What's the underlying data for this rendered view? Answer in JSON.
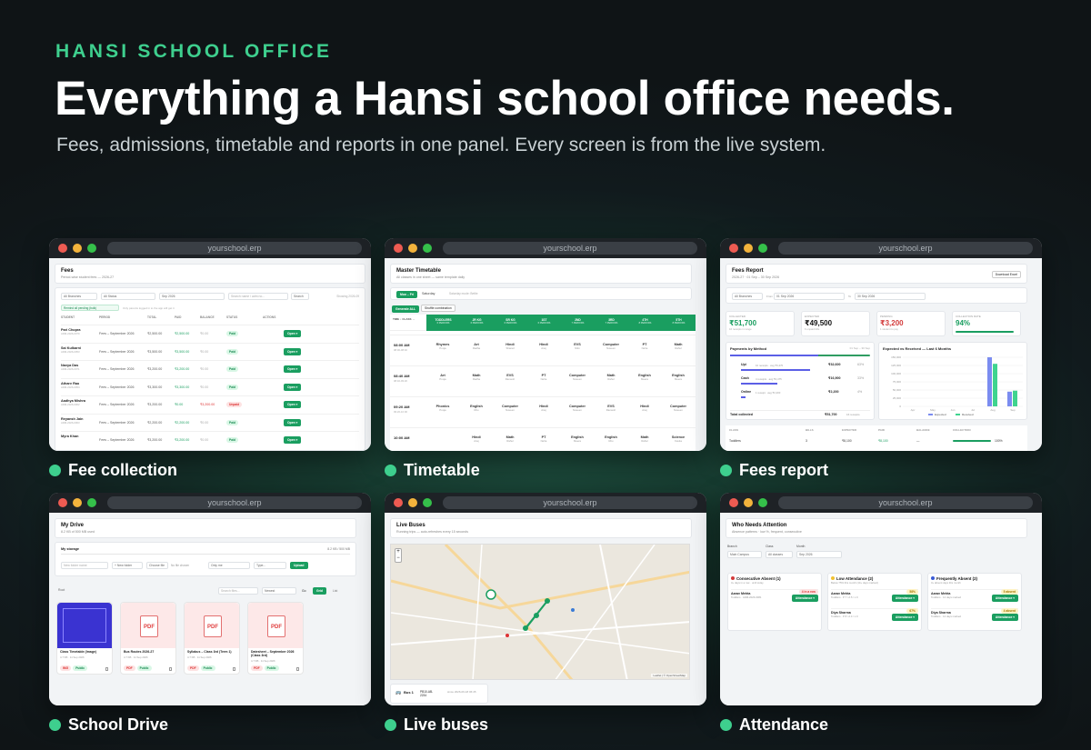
{
  "hero": {
    "eyebrow": "HANSI SCHOOL OFFICE",
    "headline": "Everything a Hansi school office needs.",
    "subheadline": "Fees, admissions, timetable and reports in one panel. Every screen is from the live system."
  },
  "browser_url": "yourschool.erp",
  "captions": {
    "fees": "Fee collection",
    "timetable": "Timetable",
    "report": "Fees report",
    "drive": "School Drive",
    "buses": "Live buses",
    "attendance": "Attendance"
  },
  "fees": {
    "title": "Fees",
    "subtitle": "Period-wise student fees — 2026-27",
    "filter_branch": "All Branches",
    "filter_status": "All Status",
    "filter_month": "Sep 2026",
    "search_placeholder": "Search name / adm no...",
    "search_button": "Search",
    "showing": "Showing 2026-09",
    "remind_button": "Remind all pending (bulk)",
    "remind_note": "Only parents logged in to the app will get it",
    "headers": [
      "STUDENT",
      "PERIOD",
      "TOTAL",
      "PAID",
      "BALANCE",
      "STATUS",
      "ACTIONS"
    ],
    "open_label": "Open ▾",
    "rows": [
      {
        "name": "Pari Chopra",
        "adm": "ADM-2026-0079",
        "period": "Fees – September 2026",
        "total": "₹2,500.00",
        "paid": "₹2,500.00",
        "balance": "₹0.00",
        "status": "Paid"
      },
      {
        "name": "Sai Kulkarni",
        "adm": "ADM-2026-0053",
        "period": "Fees – September 2026",
        "total": "₹3,500.00",
        "paid": "₹3,500.00",
        "balance": "₹0.00",
        "status": "Paid"
      },
      {
        "name": "Navya Das",
        "adm": "ADM-2026-0071",
        "period": "Fees – September 2026",
        "total": "₹3,200.00",
        "paid": "₹3,200.00",
        "balance": "₹0.00",
        "status": "Paid"
      },
      {
        "name": "Atharv Rao",
        "adm": "ADM-2026-0054",
        "period": "Fees – September 2026",
        "total": "₹3,300.00",
        "paid": "₹3,300.00",
        "balance": "₹0.00",
        "status": "Paid"
      },
      {
        "name": "Aadhya Mishra",
        "adm": "ADM-2026-0062",
        "period": "Fees – September 2026",
        "total": "₹3,200.00",
        "paid": "₹0.00",
        "balance": "₹3,200.00",
        "status": "Unpaid"
      },
      {
        "name": "Reyansh Jain",
        "adm": "ADM-2026-0063",
        "period": "Fees – September 2026",
        "total": "₹2,200.00",
        "paid": "₹2,200.00",
        "balance": "₹0.00",
        "status": "Paid"
      },
      {
        "name": "Myra Khan",
        "adm": "",
        "period": "Fees – September 2026",
        "total": "₹3,200.00",
        "paid": "₹3,200.00",
        "balance": "₹0.00",
        "status": "Paid"
      }
    ]
  },
  "timetable": {
    "title": "Master Timetable",
    "subtitle": "All classes in one sheet — same template daily",
    "tab_active": "Mon – Fri",
    "tab_other": "Saturday",
    "tab_note": "Saturday mode: Bettie",
    "generate": "Generate ALL",
    "shuffle": "Shuffle combination",
    "corner": "TIME ↓ CLASS →",
    "classes": [
      {
        "name": "TODDLERS",
        "sub": "6 PERIODS"
      },
      {
        "name": "JR KG",
        "sub": "6 PERIODS"
      },
      {
        "name": "SR KG",
        "sub": "6 PERIODS"
      },
      {
        "name": "1ST",
        "sub": "6 PERIODS"
      },
      {
        "name": "2ND",
        "sub": "7 PERIODS"
      },
      {
        "name": "3RD",
        "sub": "7 PERIODS"
      },
      {
        "name": "4TH",
        "sub": "8 PERIODS"
      },
      {
        "name": "5TH",
        "sub": "8 PERIODS"
      }
    ],
    "rows": [
      {
        "time": "08:00 AM",
        "range": "08:00-08:40",
        "cells": [
          [
            "Rhymes",
            "Pooja"
          ],
          [
            "Art",
            "Radha"
          ],
          [
            "Hindi",
            "Sharad"
          ],
          [
            "Hindi",
            "Anuj"
          ],
          [
            "EVS",
            "Nitin"
          ],
          [
            "Computer",
            "Naveen"
          ],
          [
            "PT",
            "Neha"
          ],
          [
            "Math",
            "Rahul"
          ]
        ]
      },
      {
        "time": "08:40 AM",
        "range": "08:40-09:20",
        "cells": [
          [
            "Art",
            "Pooja"
          ],
          [
            "Math",
            "Radha"
          ],
          [
            "EVS",
            "Ramesh"
          ],
          [
            "PT",
            "Neha"
          ],
          [
            "Computer",
            "Naveen"
          ],
          [
            "Math",
            "Rahul"
          ],
          [
            "English",
            "Meera"
          ],
          [
            "English",
            "Meera"
          ]
        ]
      },
      {
        "time": "09:20 AM",
        "range": "09:20-10:00",
        "cells": [
          [
            "Phonics",
            "Pooja"
          ],
          [
            "English",
            "Ritu"
          ],
          [
            "Computer",
            "Naveen"
          ],
          [
            "Hindi",
            "Anuj"
          ],
          [
            "Computer",
            "Naveen"
          ],
          [
            "EVS",
            "Ramesh"
          ],
          [
            "Hindi",
            "Anuj"
          ],
          [
            "Computer",
            "Naveen"
          ]
        ]
      },
      {
        "time": "10:00 AM",
        "range": "",
        "cells": [
          [
            "",
            ""
          ],
          [
            "Hindi",
            "Anuj"
          ],
          [
            "Math",
            "Rahul"
          ],
          [
            "PT",
            "Neha"
          ],
          [
            "English",
            "Meera"
          ],
          [
            "English",
            "Ritu"
          ],
          [
            "Math",
            "Rahul"
          ],
          [
            "Science",
            "Kavita"
          ]
        ]
      }
    ]
  },
  "report": {
    "title": "Fees Report",
    "subtitle": "2026-27 · 01 Sep – 30 Sep 2026",
    "download": "Download Excel",
    "branch": "All Branches",
    "from_label": "From",
    "from": "01 Sep 2026",
    "to_label": "To",
    "to": "30 Sep 2026",
    "stats": [
      {
        "label": "COLLECTED",
        "value": "₹51,700",
        "sub": "16 receipts in range",
        "color": "#1a9e60"
      },
      {
        "label": "EXPECTED",
        "value": "₹49,500",
        "sub": "6 unpaid bills",
        "color": "#111111"
      },
      {
        "label": "PENDING",
        "value": "₹3,200",
        "sub": "1 student to pay",
        "color": "#d33b3b"
      },
      {
        "label": "COLLECTION RATE",
        "value": "94%",
        "sub": "",
        "color": "#1a9e60"
      }
    ],
    "methods_title": "Payments by Method",
    "methods_range": "01 Sep – 30 Sep",
    "methods": [
      {
        "name": "Upi",
        "note": "10 receipts · avg ₹3,270",
        "amount": "₹32,600",
        "pct": "63%"
      },
      {
        "name": "Cash",
        "note": "4 receipts · avg ₹4,475",
        "amount": "₹16,900",
        "pct": "33%"
      },
      {
        "name": "Online",
        "note": "1 receipt · avg ₹2,200",
        "amount": "₹2,200",
        "pct": "4%"
      }
    ],
    "total_label": "Total collected",
    "total_value": "₹51,700",
    "total_note": "16 receipts",
    "chart_title": "Expected vs Received — Last 6 Months",
    "legend_expected": "Expected",
    "legend_received": "Received",
    "table_headers": [
      "CLASS",
      "BILLS",
      "EXPECTED",
      "PAID",
      "BALANCE",
      "COLLECTION"
    ],
    "table_row": {
      "class": "Toddlers",
      "bills": "3",
      "expected": "₹8,100",
      "paid": "₹8,100",
      "balance": "—",
      "collection": "100%"
    }
  },
  "chart_data": {
    "type": "bar",
    "title": "Expected vs Received — Last 6 Months",
    "categories": [
      "Apr",
      "May",
      "Jun",
      "Jul",
      "Aug",
      "Sep"
    ],
    "series": [
      {
        "name": "Expected",
        "values": [
          0,
          0,
          0,
          0,
          150000,
          45000
        ]
      },
      {
        "name": "Received",
        "values": [
          0,
          0,
          0,
          0,
          130000,
          48000
        ]
      }
    ],
    "yticks": [
      "150,000",
      "125,000",
      "100,000",
      "75,000",
      "50,000",
      "25,000",
      "0"
    ],
    "ylim": [
      0,
      150000
    ]
  },
  "drive": {
    "title": "My Drive",
    "subtitle": "8.2 KB of 500 MB used",
    "storage_label": "My storage",
    "storage_value": "8.2 KB / 500 MB",
    "folder_placeholder": "New folder name",
    "new_folder": "+ New folder",
    "choose_file": "Choose file",
    "no_file": "No file chosen",
    "visibility": "Only me",
    "type": "Type...",
    "upload": "Upload",
    "root": "Root",
    "search_placeholder": "Search files...",
    "sort": "Newest",
    "go": "Go",
    "grid": "Grid",
    "list": "List",
    "files": [
      {
        "name": "Class Timetable (Image)",
        "meta": "4.7 KB · 11 Sep 2026",
        "kind": "IMG",
        "vis": "Public"
      },
      {
        "name": "Bus Routes 2026-27",
        "meta": "4.7 KB · 11 Sep 2026",
        "kind": "PDF",
        "vis": "Public"
      },
      {
        "name": "Syllabus – Class 3rd (Term 1)",
        "meta": "4.7 KB · 11 Sep 2026",
        "kind": "PDF",
        "vis": "Public"
      },
      {
        "name": "Datesheet – September 2026 (Class 3rd)",
        "meta": "4.7 KB · 11 Sep 2026",
        "kind": "PDF",
        "vis": "Public"
      }
    ]
  },
  "buses": {
    "title": "Live Buses",
    "subtitle": "Running trips — auto-refreshes every 15 seconds",
    "zoom_in": "+",
    "zoom_out": "−",
    "attribution": "Leaflet | © OpenStreetMap",
    "bus_label": "Bus 1",
    "bus_plate": "PB10-AB-2234",
    "bus_time": "since 2026-09-18 06:45"
  },
  "attendance": {
    "title": "Who Needs Attention",
    "subtitle": "Absence patterns · low %, frequent, consecutive",
    "branch_label": "Branch",
    "branch": "Main Campus",
    "class_label": "Class",
    "class": "All classes",
    "month_label": "Month",
    "month": "Sep 2026",
    "button": "Attendance ▾",
    "groups": [
      {
        "title": "Consecutive Absent (1)",
        "sub": "3+ days in a row · until today",
        "people": [
          {
            "name": "Aarav Mehta",
            "info": "Toddlers · ADM-2026-0081",
            "tag": "4 in a row"
          }
        ]
      },
      {
        "title": "Low Attendance (2)",
        "sub": "Below 75% this month (10+ days marked)",
        "people": [
          {
            "name": "Aarav Mehta",
            "info": "Toddlers · P 7 / A 5 / L 0",
            "tag": "58%"
          },
          {
            "name": "Diya Sharma",
            "info": "Toddlers · P 8 / A 4 / L 0",
            "tag": "67%"
          }
        ]
      },
      {
        "title": "Frequently Absent (2)",
        "sub": "3+ absent days this month",
        "people": [
          {
            "name": "Aarav Mehta",
            "info": "Toddlers · 12 days marked",
            "tag": "5 absent"
          },
          {
            "name": "Diya Sharma",
            "info": "Toddlers · 12 days marked",
            "tag": "4 absent"
          }
        ]
      }
    ]
  },
  "colors": {
    "accent": "#3ecf8e",
    "brand_green": "#1a9e60",
    "expected_bar": "#7b8cf0",
    "received_bar": "#3fd48f"
  }
}
